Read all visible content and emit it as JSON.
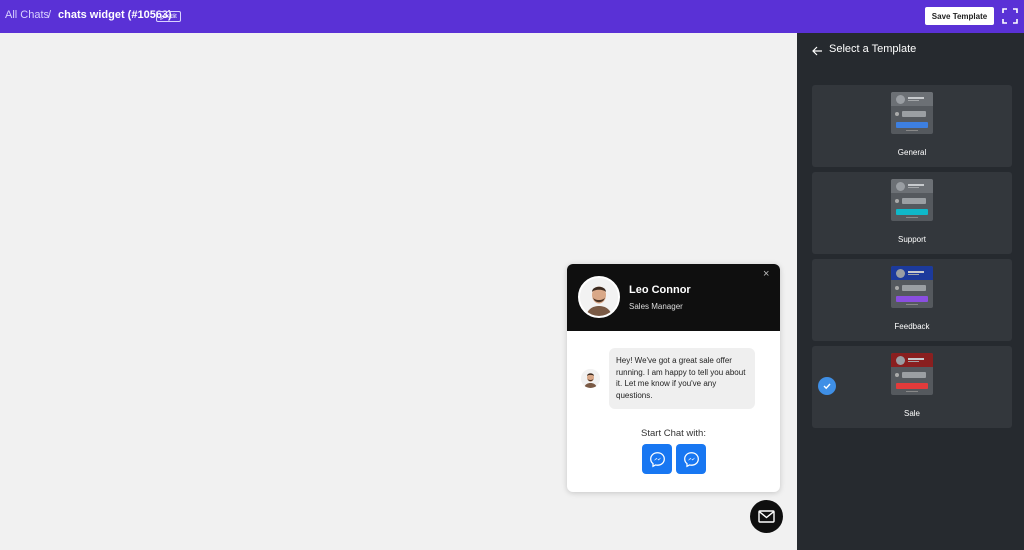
{
  "header": {
    "breadcrumb_root": "All Chats",
    "breadcrumb_separator": "/",
    "widget_title": "chats widget (#10563)",
    "edit_label": "edit",
    "save_label": "Save Template",
    "fullscreen_icon": "fullscreen-icon",
    "bar_color": "#5a31d6"
  },
  "panel": {
    "title": "Select a Template",
    "back_icon": "arrow-left-icon",
    "templates": [
      {
        "label": "General",
        "accent": "#3d7fe0",
        "head": "#6c7075",
        "selected": false
      },
      {
        "label": "Support",
        "accent": "#0fb8c9",
        "head": "#6c7075",
        "selected": false
      },
      {
        "label": "Feedback",
        "accent": "#8a4fe0",
        "head": "#1c3a9c",
        "selected": false
      },
      {
        "label": "Sale",
        "accent": "#e23b3b",
        "head": "#8a1f1f",
        "selected": true
      }
    ],
    "check_color": "#3f8fe6"
  },
  "widget": {
    "close_glyph": "×",
    "agent_name": "Leo Connor",
    "agent_role": "Sales Manager",
    "message": "Hey! We've got a great sale offer running. I am happy to tell you about it. Let me know if you've any questions.",
    "start_label": "Start Chat with:",
    "channels": [
      "messenger-icon",
      "messenger-icon"
    ],
    "channel_color": "#1877f2",
    "header_color": "#0f0f0f"
  },
  "launcher": {
    "icon": "mail-icon"
  }
}
